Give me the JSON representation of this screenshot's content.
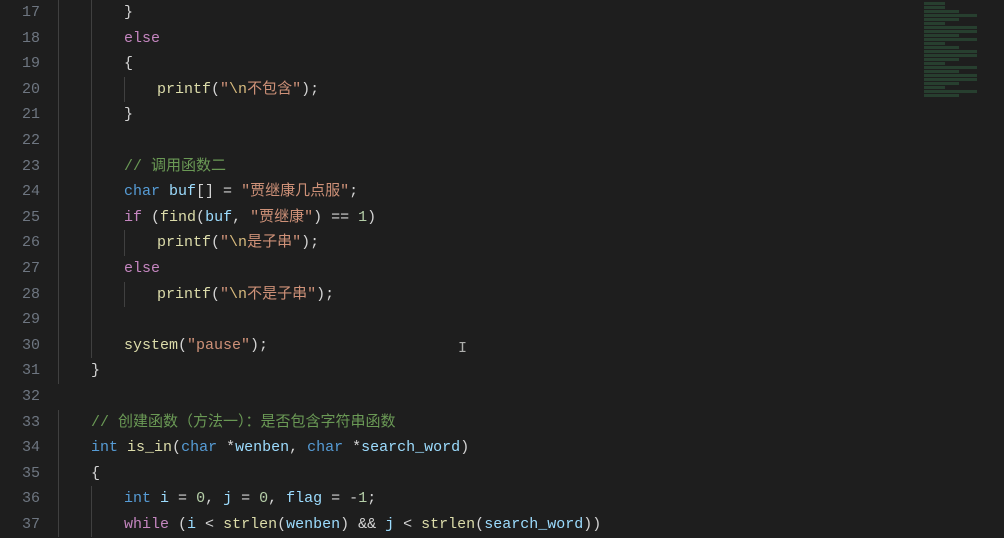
{
  "editor": {
    "startLine": 17,
    "lines": [
      {
        "n": 17,
        "indent": 2,
        "tokens": [
          {
            "t": "}",
            "c": "brace"
          }
        ]
      },
      {
        "n": 18,
        "indent": 2,
        "tokens": [
          {
            "t": "else",
            "c": "keyword"
          }
        ]
      },
      {
        "n": 19,
        "indent": 2,
        "tokens": [
          {
            "t": "{",
            "c": "brace"
          }
        ]
      },
      {
        "n": 20,
        "indent": 3,
        "tokens": [
          {
            "t": "printf",
            "c": "func"
          },
          {
            "t": "(",
            "c": "op"
          },
          {
            "t": "\"",
            "c": "string"
          },
          {
            "t": "\\n",
            "c": "escape"
          },
          {
            "t": "不包含\"",
            "c": "string"
          },
          {
            "t": ");",
            "c": "op"
          }
        ]
      },
      {
        "n": 21,
        "indent": 2,
        "tokens": [
          {
            "t": "}",
            "c": "brace"
          }
        ]
      },
      {
        "n": 22,
        "indent": 2,
        "tokens": []
      },
      {
        "n": 23,
        "indent": 2,
        "tokens": [
          {
            "t": "// 调用函数二",
            "c": "comment"
          }
        ]
      },
      {
        "n": 24,
        "indent": 2,
        "tokens": [
          {
            "t": "char",
            "c": "type"
          },
          {
            "t": " ",
            "c": "op"
          },
          {
            "t": "buf",
            "c": "var"
          },
          {
            "t": "[] = ",
            "c": "op"
          },
          {
            "t": "\"贾继康几点服\"",
            "c": "string"
          },
          {
            "t": ";",
            "c": "op"
          }
        ]
      },
      {
        "n": 25,
        "indent": 2,
        "tokens": [
          {
            "t": "if",
            "c": "keyword"
          },
          {
            "t": " (",
            "c": "op"
          },
          {
            "t": "find",
            "c": "func"
          },
          {
            "t": "(",
            "c": "op"
          },
          {
            "t": "buf",
            "c": "var"
          },
          {
            "t": ", ",
            "c": "op"
          },
          {
            "t": "\"贾继康\"",
            "c": "string"
          },
          {
            "t": ") == ",
            "c": "op"
          },
          {
            "t": "1",
            "c": "num"
          },
          {
            "t": ")",
            "c": "op"
          }
        ]
      },
      {
        "n": 26,
        "indent": 3,
        "tokens": [
          {
            "t": "printf",
            "c": "func"
          },
          {
            "t": "(",
            "c": "op"
          },
          {
            "t": "\"",
            "c": "string"
          },
          {
            "t": "\\n",
            "c": "escape"
          },
          {
            "t": "是子串\"",
            "c": "string"
          },
          {
            "t": ");",
            "c": "op"
          }
        ]
      },
      {
        "n": 27,
        "indent": 2,
        "tokens": [
          {
            "t": "else",
            "c": "keyword"
          }
        ]
      },
      {
        "n": 28,
        "indent": 3,
        "tokens": [
          {
            "t": "printf",
            "c": "func"
          },
          {
            "t": "(",
            "c": "op"
          },
          {
            "t": "\"",
            "c": "string"
          },
          {
            "t": "\\n",
            "c": "escape"
          },
          {
            "t": "不是子串\"",
            "c": "string"
          },
          {
            "t": ");",
            "c": "op"
          }
        ]
      },
      {
        "n": 29,
        "indent": 2,
        "tokens": []
      },
      {
        "n": 30,
        "indent": 2,
        "tokens": [
          {
            "t": "system",
            "c": "func"
          },
          {
            "t": "(",
            "c": "op"
          },
          {
            "t": "\"pause\"",
            "c": "string"
          },
          {
            "t": ");",
            "c": "op"
          }
        ]
      },
      {
        "n": 31,
        "indent": 1,
        "tokens": [
          {
            "t": "}",
            "c": "brace"
          }
        ]
      },
      {
        "n": 32,
        "indent": 0,
        "tokens": []
      },
      {
        "n": 33,
        "indent": 1,
        "tokens": [
          {
            "t": "// 创建函数（方法一）：是否包含字符串函数",
            "c": "comment"
          }
        ]
      },
      {
        "n": 34,
        "indent": 1,
        "tokens": [
          {
            "t": "int",
            "c": "type"
          },
          {
            "t": " ",
            "c": "op"
          },
          {
            "t": "is_in",
            "c": "func"
          },
          {
            "t": "(",
            "c": "op"
          },
          {
            "t": "char",
            "c": "type"
          },
          {
            "t": " *",
            "c": "op"
          },
          {
            "t": "wenben",
            "c": "var"
          },
          {
            "t": ", ",
            "c": "op"
          },
          {
            "t": "char",
            "c": "type"
          },
          {
            "t": " *",
            "c": "op"
          },
          {
            "t": "search_word",
            "c": "var"
          },
          {
            "t": ")",
            "c": "op"
          }
        ]
      },
      {
        "n": 35,
        "indent": 1,
        "tokens": [
          {
            "t": "{",
            "c": "brace"
          }
        ]
      },
      {
        "n": 36,
        "indent": 2,
        "tokens": [
          {
            "t": "int",
            "c": "type"
          },
          {
            "t": " ",
            "c": "op"
          },
          {
            "t": "i",
            "c": "var"
          },
          {
            "t": " = ",
            "c": "op"
          },
          {
            "t": "0",
            "c": "num"
          },
          {
            "t": ", ",
            "c": "op"
          },
          {
            "t": "j",
            "c": "var"
          },
          {
            "t": " = ",
            "c": "op"
          },
          {
            "t": "0",
            "c": "num"
          },
          {
            "t": ", ",
            "c": "op"
          },
          {
            "t": "flag",
            "c": "var"
          },
          {
            "t": " = -",
            "c": "op"
          },
          {
            "t": "1",
            "c": "num"
          },
          {
            "t": ";",
            "c": "op"
          }
        ]
      },
      {
        "n": 37,
        "indent": 2,
        "tokens": [
          {
            "t": "while",
            "c": "keyword"
          },
          {
            "t": " (",
            "c": "op"
          },
          {
            "t": "i",
            "c": "var"
          },
          {
            "t": " < ",
            "c": "op"
          },
          {
            "t": "strlen",
            "c": "func"
          },
          {
            "t": "(",
            "c": "op"
          },
          {
            "t": "wenben",
            "c": "var"
          },
          {
            "t": ") && ",
            "c": "op"
          },
          {
            "t": "j",
            "c": "var"
          },
          {
            "t": " < ",
            "c": "op"
          },
          {
            "t": "strlen",
            "c": "func"
          },
          {
            "t": "(",
            "c": "op"
          },
          {
            "t": "search_word",
            "c": "var"
          },
          {
            "t": "))",
            "c": "op"
          }
        ]
      }
    ]
  }
}
